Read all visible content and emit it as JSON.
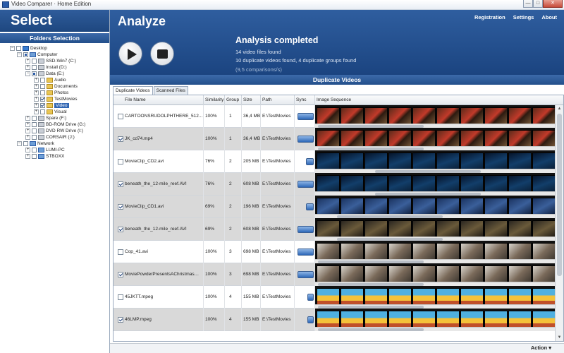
{
  "window": {
    "title": "Video Comparer  ·  Home Edition",
    "minimize": "—",
    "maximize": "□",
    "close": "✕"
  },
  "left_panel": {
    "title": "Select",
    "folders_label": "Folders Selection",
    "tree": [
      {
        "label": "Desktop",
        "icon": "desktop-icon",
        "expander": "−",
        "check": "none"
      },
      {
        "label": "Computer",
        "icon": "computer-icon",
        "expander": "−",
        "check": "partial"
      },
      {
        "label": "SSD-Win7 (C:)",
        "icon": "drive-icon",
        "expander": "+",
        "check": "none"
      },
      {
        "label": "Install (D:)",
        "icon": "drive-icon",
        "expander": "+",
        "check": "none"
      },
      {
        "label": "Data (E:)",
        "icon": "drive-icon",
        "expander": "−",
        "check": "partial"
      },
      {
        "label": "Audio",
        "icon": "folder-icon",
        "expander": "+",
        "check": "none"
      },
      {
        "label": "Documents",
        "icon": "folder-icon",
        "expander": "+",
        "check": "none"
      },
      {
        "label": "Photos",
        "icon": "folder-icon",
        "expander": "+",
        "check": "none"
      },
      {
        "label": "TestMovies",
        "icon": "folder-icon",
        "expander": "+",
        "check": "checked"
      },
      {
        "label": "Video",
        "icon": "folder-icon",
        "expander": "+",
        "check": "checked",
        "selected": true
      },
      {
        "label": "Visual",
        "icon": "folder-icon",
        "expander": "+",
        "check": "none"
      },
      {
        "label": "Spare (F:)",
        "icon": "drive-icon",
        "expander": "+",
        "check": "none"
      },
      {
        "label": "BD-ROM Drive (G:)",
        "icon": "disc-drive-icon",
        "expander": "+",
        "check": "none"
      },
      {
        "label": "DVD RW Drive (I:)",
        "icon": "disc-drive-icon",
        "expander": "+",
        "check": "none"
      },
      {
        "label": "CORSAIR (J:)",
        "icon": "drive-icon",
        "expander": "+",
        "check": "none"
      },
      {
        "label": "Network",
        "icon": "network-icon",
        "expander": "−",
        "check": "none"
      },
      {
        "label": "LUMI-PC",
        "icon": "computer-icon",
        "expander": "+",
        "check": "none"
      },
      {
        "label": "STBOXX",
        "icon": "computer-icon",
        "expander": "+",
        "check": "none"
      }
    ]
  },
  "analyze": {
    "title": "Analyze",
    "nav": [
      "Registration",
      "Settings",
      "About"
    ],
    "status_title": "Analysis completed",
    "status_lines": [
      "14 video files found",
      "10 duplicate videos found, 4 duplicate groups found",
      "(9,5 comparisons/s)"
    ]
  },
  "duplicates": {
    "title": "Duplicate Videos",
    "tabs": [
      "Duplicate Videos",
      "Scanned Files"
    ],
    "columns": [
      "File Name",
      "Similarity",
      "Group",
      "Size",
      "Path",
      "Sync",
      "Image Sequence"
    ],
    "rows": [
      {
        "checked": false,
        "name": "CARTOONSRUDOLPHTHERE_512...",
        "similarity": "100%",
        "group": "1",
        "size": "36,4 MB",
        "path": "E:\\TestMovies",
        "sync": 0.9,
        "thumb": "t-xmas",
        "scroll": 0.0
      },
      {
        "checked": true,
        "name": "JK_cd74.mp4",
        "similarity": "100%",
        "group": "1",
        "size": "36,4 MB",
        "path": "E:\\TestMovies",
        "sync": 0.9,
        "thumb": "t-xmas",
        "scroll": 0.0
      },
      {
        "checked": false,
        "name": "MovieClip_CD2.avi",
        "similarity": "76%",
        "group": "2",
        "size": "205 MB",
        "path": "E:\\TestMovies",
        "sync": 0.45,
        "thumb": "t-reef",
        "scroll": 0.45
      },
      {
        "checked": true,
        "name": "beneath_the_12-mile_reef.AVI",
        "similarity": "76%",
        "group": "2",
        "size": "608 MB",
        "path": "E:\\TestMovies",
        "sync": 0.9,
        "thumb": "t-reef",
        "scroll": 0.45
      },
      {
        "checked": true,
        "name": "MovieClip_CD1.avi",
        "similarity": "69%",
        "group": "2",
        "size": "196 MB",
        "path": "E:\\TestMovies",
        "sync": 0.45,
        "thumb": "t-blue",
        "scroll": 0.15
      },
      {
        "checked": true,
        "name": "beneath_the_12-mile_reef.AVI",
        "similarity": "69%",
        "group": "2",
        "size": "608 MB",
        "path": "E:\\TestMovies",
        "sync": 0.9,
        "thumb": "t-dark",
        "scroll": 0.15
      },
      {
        "checked": false,
        "name": "Cop_41.avi",
        "similarity": "100%",
        "group": "3",
        "size": "698 MB",
        "path": "E:\\TestMovies",
        "sync": 0.9,
        "thumb": "t-people",
        "scroll": 0.0
      },
      {
        "checked": true,
        "name": "MoviePowderPresentsAChristmasWit...",
        "similarity": "100%",
        "group": "3",
        "size": "698 MB",
        "path": "E:\\TestMovies",
        "sync": 0.9,
        "thumb": "t-people",
        "scroll": 0.0
      },
      {
        "checked": false,
        "name": "45JKTT.mpeg",
        "similarity": "100%",
        "group": "4",
        "size": "155 MB",
        "path": "E:\\TestMovies",
        "sync": 0.35,
        "thumb": "t-cartoon",
        "scroll": 0.0
      },
      {
        "checked": true,
        "name": "46LMP.mpeg",
        "similarity": "100%",
        "group": "4",
        "size": "155 MB",
        "path": "E:\\TestMovies",
        "sync": 0.35,
        "thumb": "t-cartoon",
        "scroll": 0.0
      }
    ]
  },
  "footer": {
    "action_label": "Action  ▾"
  },
  "colors": {
    "header_blue": "#1e477f",
    "sync_blue": "#2d67b8",
    "row_dark": "#d9d9d9"
  }
}
